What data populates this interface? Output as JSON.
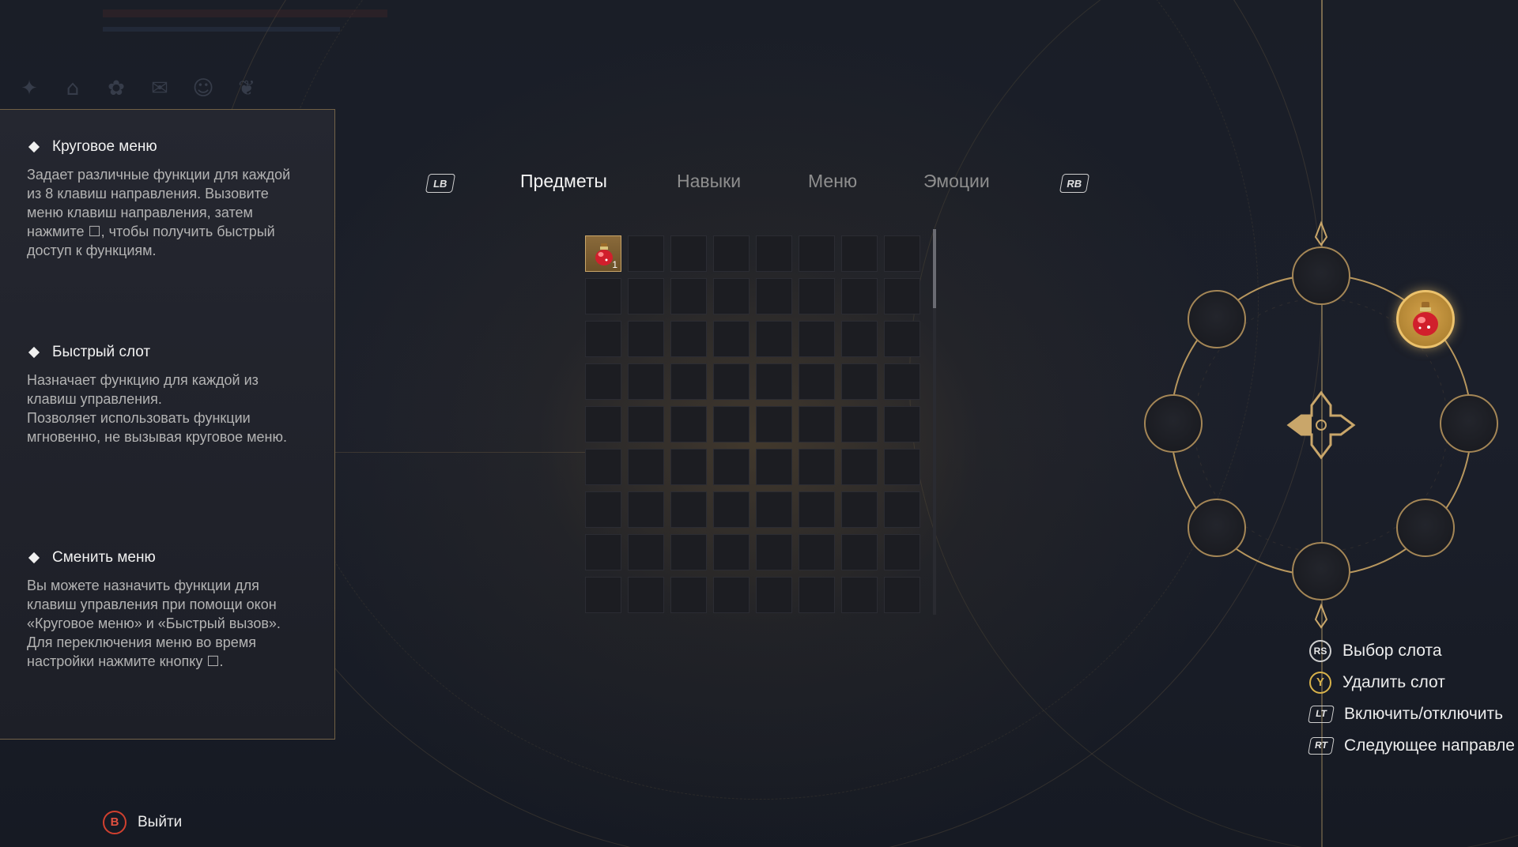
{
  "info_panel": {
    "sections": [
      {
        "title": "Круговое меню",
        "body": "Задает различные функции для каждой из 8 клавиш направления. Вызовите меню клавиш направления, затем нажмите ☐, чтобы получить быстрый доступ к функциям."
      },
      {
        "title": "Быстрый слот",
        "body": "Назначает функцию для каждой из клавиш управления.\nПозволяет использовать функции мгновенно, не вызывая круговое меню."
      },
      {
        "title": "Сменить меню",
        "body": "Вы можете назначить функции для клавиш управления при помощи окон «Круговое меню» и «Быстрый вызов».\nДля переключения меню во время настройки нажмите кнопку ☐."
      }
    ]
  },
  "tabs": {
    "left_bumper": "LB",
    "right_bumper": "RB",
    "items": [
      "Предметы",
      "Навыки",
      "Меню",
      "Эмоции"
    ],
    "active_index": 0
  },
  "grid": {
    "columns": 8,
    "rows": 9,
    "items": [
      {
        "index": 0,
        "icon": "red-potion-icon",
        "count": "1"
      }
    ]
  },
  "radial_menu": {
    "slot_count": 8,
    "active_slot": "up-right",
    "active_slot_icon": "red-potion-icon",
    "center_icon": "dpad-icon"
  },
  "controls": [
    {
      "button": "RS",
      "label": "Выбор слота",
      "style": "circle"
    },
    {
      "button": "Y",
      "label": "Удалить слот",
      "style": "y"
    },
    {
      "button": "LT",
      "label": "Включить/отключить",
      "style": "trig"
    },
    {
      "button": "RT",
      "label": "Следующее направле",
      "style": "trig"
    }
  ],
  "exit": {
    "button": "B",
    "label": "Выйти"
  },
  "colors": {
    "accent_gold": "#c9a66a",
    "active_slot_gold": "#d4a24a",
    "exit_red": "#d0402f"
  }
}
